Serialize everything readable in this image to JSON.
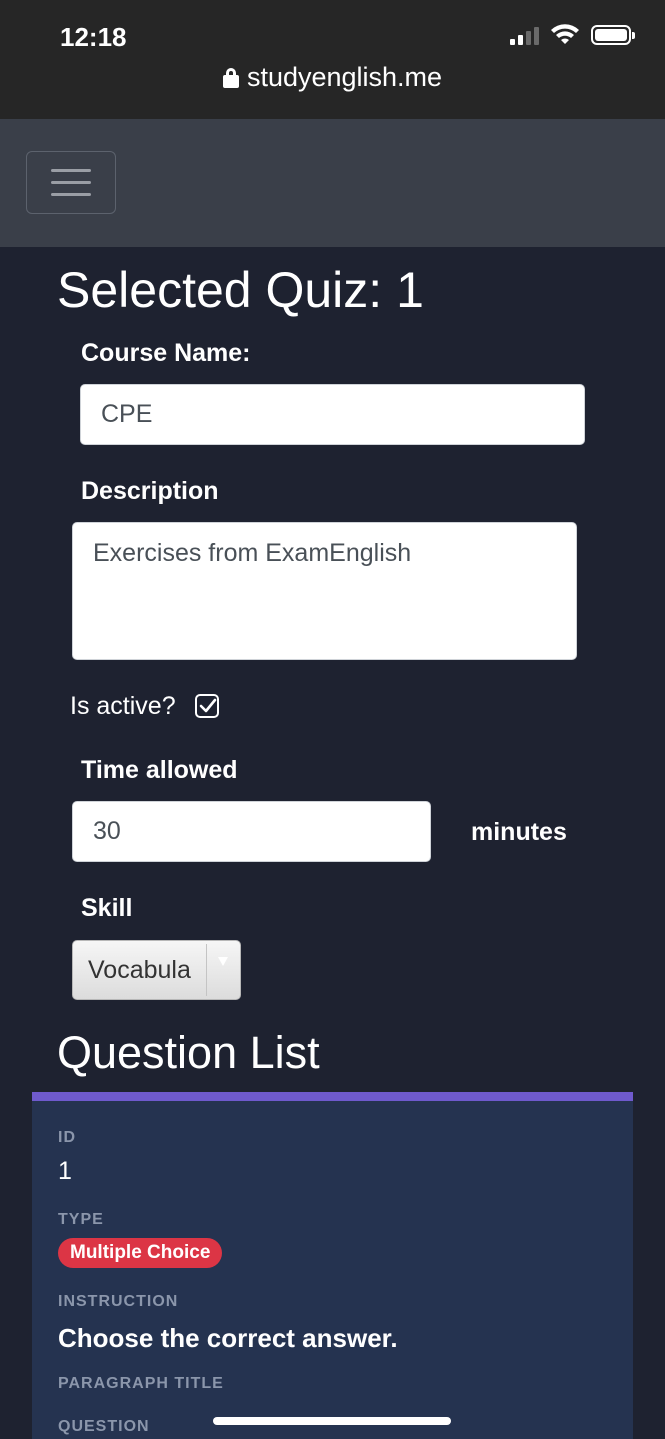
{
  "status_bar": {
    "time": "12:18"
  },
  "browser": {
    "url": "studyenglish.me"
  },
  "page": {
    "title": "Selected Quiz: 1",
    "course_name_label": "Course Name:",
    "course_name_value": "CPE",
    "description_label": "Description",
    "description_value": "Exercises from ExamEnglish",
    "is_active_label": "Is active?",
    "is_active_checked": true,
    "time_allowed_label": "Time allowed",
    "time_allowed_value": "30",
    "time_unit": "minutes",
    "skill_label": "Skill",
    "skill_value": "Vocabula"
  },
  "question_list": {
    "title": "Question List",
    "card": {
      "id_label": "ID",
      "id_value": "1",
      "type_label": "TYPE",
      "type_value": "Multiple Choice",
      "instruction_label": "INSTRUCTION",
      "instruction_value": "Choose the correct answer.",
      "paragraph_title_label": "PARAGRAPH TITLE",
      "question_label": "QUESTION"
    }
  },
  "colors": {
    "background": "#1e2230",
    "navbar": "#3a3f49",
    "card": "#253350",
    "card_accent": "#6f5acd",
    "badge": "#dc3545"
  }
}
